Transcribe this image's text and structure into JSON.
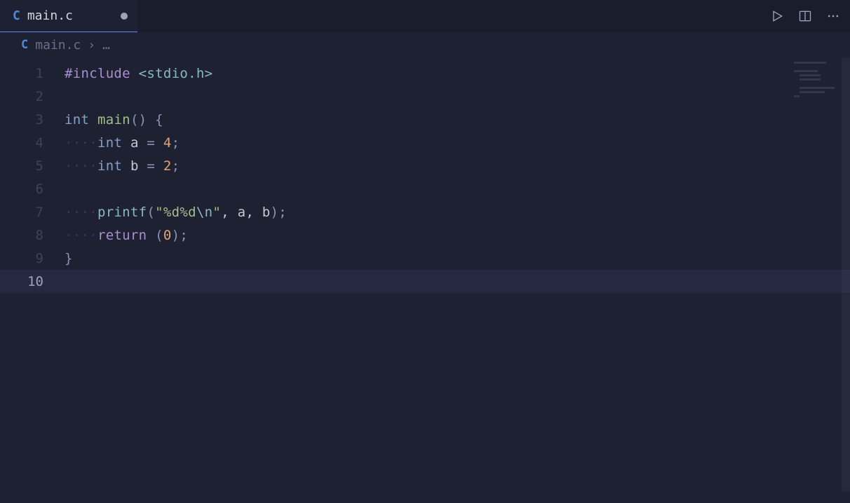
{
  "tab": {
    "filename": "main.c",
    "modified": true
  },
  "breadcrumb": {
    "filename": "main.c",
    "more": "…"
  },
  "lines": [
    {
      "n": "1",
      "type": "include",
      "directive": "#include",
      "path": "<stdio.h>"
    },
    {
      "n": "2",
      "type": "blank"
    },
    {
      "n": "3",
      "type": "funcdef",
      "ret": "int",
      "name": "main",
      "after": "() {"
    },
    {
      "n": "4",
      "type": "decl",
      "indent": "····",
      "dtype": "int",
      "var": "a",
      "eq": " = ",
      "val": "4",
      "semi": ";"
    },
    {
      "n": "5",
      "type": "decl",
      "indent": "····",
      "dtype": "int",
      "var": "b",
      "eq": " = ",
      "val": "2",
      "semi": ";"
    },
    {
      "n": "6",
      "type": "blank"
    },
    {
      "n": "7",
      "type": "printf",
      "indent": "····",
      "fn": "printf",
      "open": "(",
      "s1": "\"",
      "fmt": "%d%d",
      "esc": "\\n",
      "s2": "\"",
      "args": ", a, b",
      "close": ");"
    },
    {
      "n": "8",
      "type": "return",
      "indent": "····",
      "kw": "return",
      "open": " (",
      "val": "0",
      "close": ");"
    },
    {
      "n": "9",
      "type": "closebrace",
      "brace": "}"
    },
    {
      "n": "10",
      "type": "blank",
      "current": true
    }
  ]
}
